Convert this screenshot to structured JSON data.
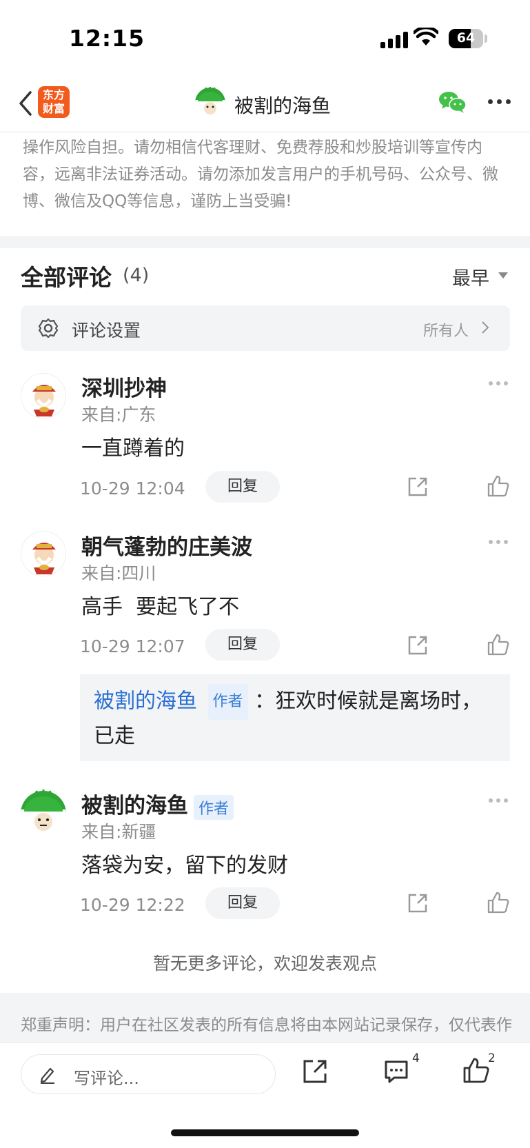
{
  "status_bar": {
    "time": "12:15",
    "battery": "64",
    "battery_level": 0.64
  },
  "nav": {
    "app_logo_line1": "东方",
    "app_logo_line2": "财富",
    "title": "被割的海鱼"
  },
  "risk_notice": "操作风险自担。请勿相信代客理财、免费荐股和炒股培训等宣传内容，远离非法证券活动。请勿添加发言用户的手机号码、公众号、微博、微信及QQ等信息，谨防上当受骗!",
  "comments_header": {
    "title": "全部评论",
    "count": "(4)",
    "sort": "最早"
  },
  "settings": {
    "label": "评论设置",
    "value": "所有人"
  },
  "comments": [
    {
      "name": "深圳抄神",
      "location": "来自:广东",
      "text": "一直蹲着的",
      "time": "10-29 12:04",
      "reply": "回复"
    },
    {
      "name": "朝气蓬勃的庄美波",
      "location": "来自:四川",
      "text": "高手  要起飞了不",
      "time": "10-29 12:07",
      "reply": "回复"
    },
    {
      "name": "被割的海鱼",
      "author_tag": "作者",
      "location": "来自:新疆",
      "text": "落袋为安，留下的发财",
      "time": "10-29 12:22",
      "reply": "回复"
    }
  ],
  "nested_reply": {
    "name": "被割的海鱼",
    "tag": "作者",
    "text": "：狂欢时候就是离场时，已走"
  },
  "no_more": "暂无更多评论，欢迎发表观点",
  "disclaimer": "郑重声明：用户在社区发表的所有信息将由本网站记录保存，仅代表作者个人观点，与本网站立场无关，不对您构成任何投资建议",
  "bottom_bar": {
    "placeholder": "写评论...",
    "comment_count": "4",
    "like_count": "2"
  },
  "colors": {
    "brand": "#f25a1e",
    "link": "#2a6fd1",
    "wechat": "#44c14a"
  }
}
